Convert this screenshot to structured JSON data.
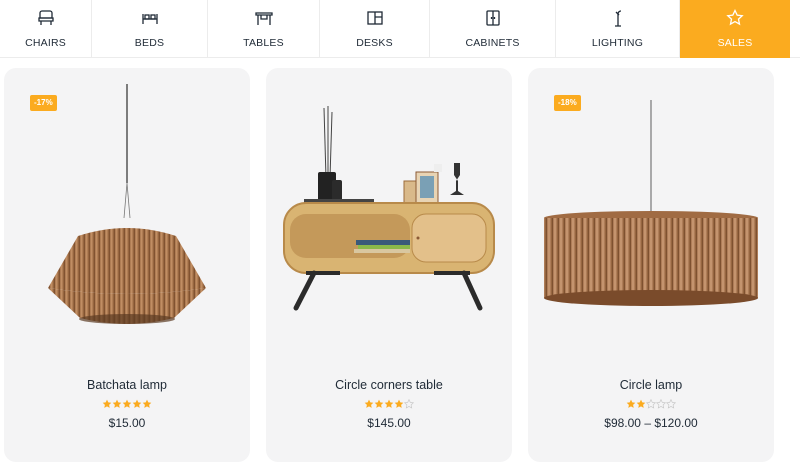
{
  "nav": {
    "items": [
      {
        "label": "CHAIRS",
        "icon": "chair-icon"
      },
      {
        "label": "BEDS",
        "icon": "bed-icon"
      },
      {
        "label": "TABLES",
        "icon": "table-icon"
      },
      {
        "label": "DESKS",
        "icon": "desk-icon"
      },
      {
        "label": "CABINETS",
        "icon": "cabinet-icon"
      },
      {
        "label": "LIGHTING",
        "icon": "lamp-icon"
      },
      {
        "label": "SALES",
        "icon": "star-icon",
        "active": true
      }
    ],
    "accent_color": "#fbab1f"
  },
  "products": [
    {
      "name": "Batchata lamp",
      "badge": "-17%",
      "rating": 5,
      "price": "$15.00",
      "image": "pendant-lamp-drum"
    },
    {
      "name": "Circle corners table",
      "badge": "",
      "rating": 4,
      "price": "$145.00",
      "image": "tv-table"
    },
    {
      "name": "Circle lamp",
      "badge": "-18%",
      "rating": 2,
      "price": "$98.00 – $120.00",
      "image": "pendant-lamp-cylinder"
    }
  ]
}
